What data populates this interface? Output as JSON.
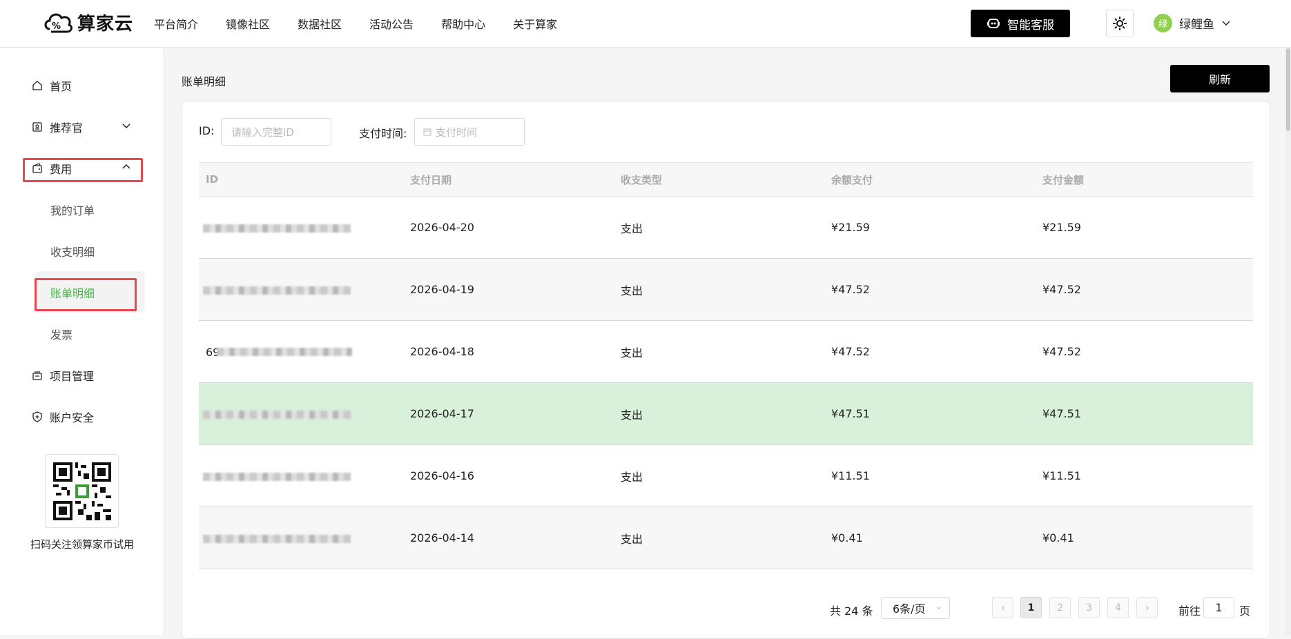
{
  "header": {
    "logo_text": "算家云",
    "nav": [
      "平台简介",
      "镜像社区",
      "数据社区",
      "活动公告",
      "帮助中心",
      "关于算家"
    ],
    "service_label": "智能客服",
    "user_avatar": "绿",
    "user_name": "绿鲤鱼"
  },
  "sidebar": {
    "home": "首页",
    "referrer": "推荐官",
    "fees": "费用",
    "fees_sub": [
      "我的订单",
      "收支明细",
      "账单明细",
      "发票"
    ],
    "project": "项目管理",
    "security": "账户安全",
    "qr_caption": "扫码关注领算家币试用"
  },
  "main": {
    "title": "账单明细",
    "refresh_label": "刷新",
    "filter_id_label": "ID:",
    "filter_id_placeholder": "请输入完整ID",
    "filter_time_label": "支付时间:",
    "filter_time_placeholder": "支付时间",
    "columns": [
      "ID",
      "支付日期",
      "收支类型",
      "余额支付",
      "支付金额"
    ],
    "rows": [
      {
        "id_prefix": "",
        "date": "2026-04-20",
        "type": "支出",
        "balance": "¥21.59",
        "amount": "¥21.59"
      },
      {
        "id_prefix": "",
        "date": "2026-04-19",
        "type": "支出",
        "balance": "¥47.52",
        "amount": "¥47.52"
      },
      {
        "id_prefix": "69",
        "date": "2026-04-18",
        "type": "支出",
        "balance": "¥47.52",
        "amount": "¥47.52"
      },
      {
        "id_prefix": "",
        "date": "2026-04-17",
        "type": "支出",
        "balance": "¥47.51",
        "amount": "¥47.51"
      },
      {
        "id_prefix": "",
        "date": "2026-04-16",
        "type": "支出",
        "balance": "¥11.51",
        "amount": "¥11.51"
      },
      {
        "id_prefix": "",
        "date": "2026-04-14",
        "type": "支出",
        "balance": "¥0.41",
        "amount": "¥0.41"
      }
    ],
    "pagination": {
      "total_text": "共 24 条",
      "page_size": "6条/页",
      "pages": [
        "1",
        "2",
        "3",
        "4"
      ],
      "current_page": "1",
      "goto_label": "前往",
      "goto_value": "1",
      "goto_suffix": "页"
    }
  },
  "colors": {
    "accent_green": "#49b44a",
    "selected_row": "#d9f0da",
    "highlight_box": "#e8474e"
  }
}
